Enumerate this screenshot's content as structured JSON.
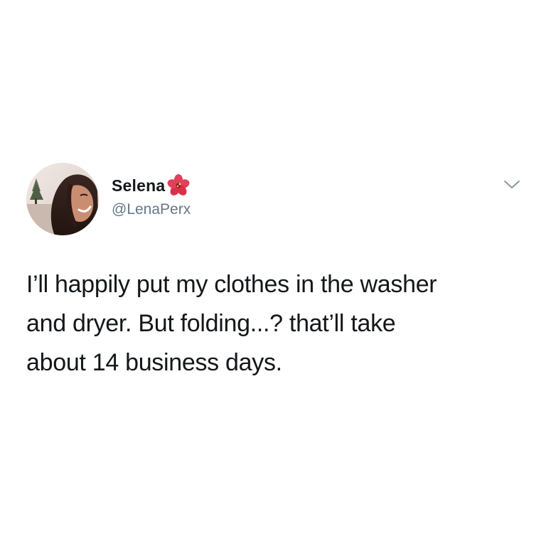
{
  "tweet": {
    "author": {
      "display_name": "Selena",
      "handle": "@LenaPerx",
      "name_emoji_icon": "hibiscus-flower-icon",
      "avatar": "profile-photo-avatar"
    },
    "menu_icon": "chevron-down-icon",
    "text_lines": [
      "I’ll happily put my clothes in the washer",
      "and dryer. But folding...? that’ll take",
      "about 14 business days."
    ]
  },
  "colors": {
    "text_primary": "#14171a",
    "text_secondary": "#657786",
    "background": "#ffffff",
    "flower": "#d9304a"
  }
}
